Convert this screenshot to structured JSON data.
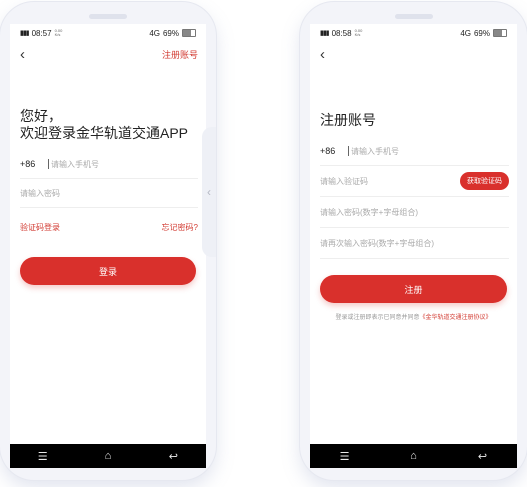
{
  "login": {
    "time": "08:57",
    "net_speed": "0.00\nK/s",
    "signal": "4G",
    "battery": "69%",
    "battery_level": 0.69,
    "register_link": "注册账号",
    "greeting_line1": "您好，",
    "greeting_line2": "欢迎登录金华轨道交通APP",
    "country_code": "+86",
    "phone_placeholder": "请输入手机号",
    "password_placeholder": "请输入密码",
    "sms_login": "验证码登录",
    "forgot_password": "忘记密码?",
    "login_button": "登录"
  },
  "register": {
    "time": "08:58",
    "net_speed": "0.00\nK/s",
    "signal": "4G",
    "battery": "69%",
    "battery_level": 0.69,
    "title": "注册账号",
    "country_code": "+86",
    "phone_placeholder": "请输入手机号",
    "code_placeholder": "请输入验证码",
    "get_code_button": "获取验证码",
    "password_placeholder": "请输入密码(数字+字母组合)",
    "confirm_placeholder": "请再次输入密码(数字+字母组合)",
    "register_button": "注册",
    "agreement_prefix": "登录或注册即表示已同意并同意",
    "agreement_link": "《金华轨道交通注册协议》"
  },
  "icons": {
    "back": "‹",
    "menu": "☰",
    "home": "⌂",
    "return": "↩",
    "side_arrow": "‹"
  },
  "colors": {
    "accent": "#d9302c"
  }
}
